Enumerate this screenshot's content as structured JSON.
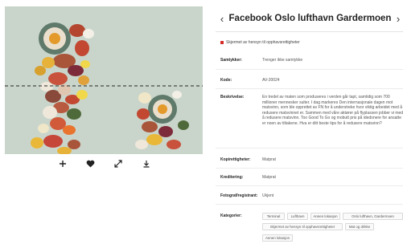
{
  "title": "Facebook Oslo lufthavn Gardermoen",
  "nav": {
    "prev": "‹",
    "next": "›"
  },
  "status": {
    "text": "Skjermet av hensyn til opphavsrettigheter",
    "color": "#d62b2b"
  },
  "fields": {
    "samtykker_label": "Samtykker:",
    "samtykker_value": "Trenger ikke samtykke",
    "kode_label": "Kode:",
    "kode_value": "AV-20024",
    "beskrivelse_label": "Beskrivelse:",
    "beskrivelse_value": "En tredel av maten som produseres i verden går tapt, samtidig som 700 millioner mennesker sulter. I dag markeres Den internasjonale dagen mot matsvinn, som ble opprettet av FN for å understreke hvor viktig arbeidet med å redusere matsvinnet er. Sammen med våre aktører på flyplassen jobber vi med å redusere matsvinn. Too Good To Go og mobutt pris på idedonere for ansatte er noen av tiltakene. Hva er ditt beste tips for å redusere matsvinn?",
    "kopirettigheter_label": "Kopirettigheter:",
    "kopirettigheter_value": "Matprat",
    "kreditering_label": "Kreditering:",
    "kreditering_value": "Matprat",
    "fotograf_label": "Fotograf/registrant:",
    "fotograf_value": "Ukjent",
    "kategorier_label": "Kategorier:"
  },
  "tags": [
    "Terminal",
    "Lufthavn",
    "Annen lokasjon",
    "Oslo lufthavn, Gardermoen",
    "Skjermet av hensyn til opphavsrettigheter",
    "Mat og drikke",
    "Annen lokasjon"
  ],
  "actions": {
    "add": "add-icon",
    "like": "heart-icon",
    "expand": "expand-icon",
    "download": "download-icon"
  },
  "colors": {
    "photo_bg": "#c9d5cb",
    "accent": "#d62b2b"
  }
}
